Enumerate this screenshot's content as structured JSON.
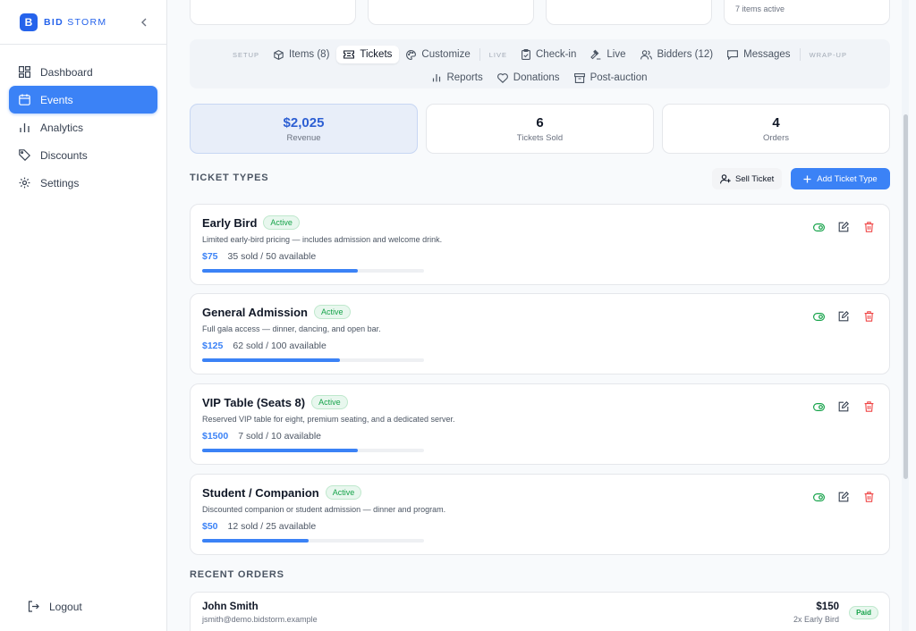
{
  "brand": {
    "logo_letter": "B",
    "name_bold": "BID",
    "name_rest": " STORM"
  },
  "sidebar": {
    "items": [
      {
        "label": "Dashboard",
        "icon": "dashboard-icon",
        "active": false
      },
      {
        "label": "Events",
        "icon": "calendar-icon",
        "active": true
      },
      {
        "label": "Analytics",
        "icon": "bar-chart-icon",
        "active": false
      },
      {
        "label": "Discounts",
        "icon": "tag-icon",
        "active": false
      },
      {
        "label": "Settings",
        "icon": "gear-icon",
        "active": false
      }
    ],
    "logout": "Logout"
  },
  "top_card": {
    "text": "7 items active"
  },
  "tabs": {
    "setup": "SETUP",
    "items": "Items  (8)",
    "tickets": "Tickets",
    "customize": "Customize",
    "live_section": "LIVE",
    "checkin": "Check-in",
    "live": "Live",
    "bidders": "Bidders  (12)",
    "messages": "Messages",
    "wrapup": "WRAP-UP",
    "reports": "Reports",
    "donations": "Donations",
    "postauction": "Post-auction"
  },
  "stats": [
    {
      "value": "$2,025",
      "label": "Revenue"
    },
    {
      "value": "6",
      "label": "Tickets Sold"
    },
    {
      "value": "4",
      "label": "Orders"
    }
  ],
  "ticket_types": {
    "title": "TICKET TYPES",
    "sell_ticket": "Sell Ticket",
    "add_ticket_type": "Add Ticket Type",
    "items": [
      {
        "name": "Early Bird",
        "status": "Active",
        "description": "Limited early-bird pricing — includes admission and welcome drink.",
        "price": "$75",
        "availability": "35 sold / 50 available",
        "sold_fraction": 0.7
      },
      {
        "name": "General Admission",
        "status": "Active",
        "description": "Full gala access — dinner, dancing, and open bar.",
        "price": "$125",
        "availability": "62 sold / 100 available",
        "sold_fraction": 0.62
      },
      {
        "name": "VIP Table (Seats 8)",
        "status": "Active",
        "description": "Reserved VIP table for eight, premium seating, and a dedicated server.",
        "price": "$1500",
        "availability": "7 sold / 10 available",
        "sold_fraction": 0.7
      },
      {
        "name": "Student / Companion",
        "status": "Active",
        "description": "Discounted companion or student admission — dinner and program.",
        "price": "$50",
        "availability": "12 sold / 25 available",
        "sold_fraction": 0.48
      }
    ]
  },
  "recent_orders": {
    "title": "RECENT ORDERS",
    "items": [
      {
        "name": "John Smith",
        "email": "jsmith@demo.bidstorm.example",
        "amount": "$150",
        "items": "2x Early Bird",
        "status": "Paid"
      }
    ]
  },
  "colors": {
    "accent": "#3b82f6",
    "active_green": "#16a34a",
    "delete_red": "#ef4444"
  }
}
